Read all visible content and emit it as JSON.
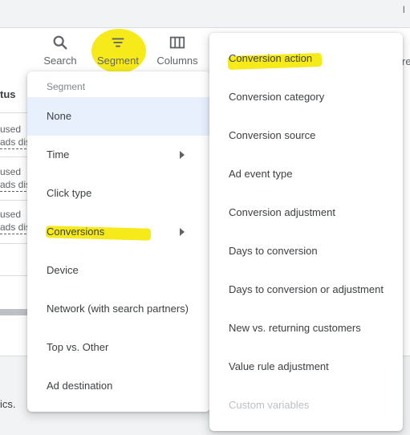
{
  "topbar": {
    "corner_letter": "l"
  },
  "toolbar": {
    "search_label": "Search",
    "segment_label": "Segment",
    "columns_label": "Columns",
    "more_label_partial": "re"
  },
  "table": {
    "column_header": "tus",
    "rows": [
      {
        "status": "used",
        "sub": "ads dis"
      },
      {
        "status": "used",
        "sub": "ads dis"
      },
      {
        "status": "used",
        "sub": "ads dis"
      }
    ]
  },
  "footer": {
    "text": "ics."
  },
  "segment_menu": {
    "header": "Segment",
    "items": [
      {
        "label": "None",
        "selected": true,
        "submenu": false
      },
      {
        "label": "Time",
        "selected": false,
        "submenu": true
      },
      {
        "label": "Click type",
        "selected": false,
        "submenu": false
      },
      {
        "label": "Conversions",
        "selected": false,
        "submenu": true
      },
      {
        "label": "Device",
        "selected": false,
        "submenu": false
      },
      {
        "label": "Network (with search partners)",
        "selected": false,
        "submenu": false
      },
      {
        "label": "Top vs. Other",
        "selected": false,
        "submenu": false
      },
      {
        "label": "Ad destination",
        "selected": false,
        "submenu": false
      }
    ]
  },
  "conversions_submenu": {
    "items": [
      {
        "label": "Conversion action",
        "disabled": false
      },
      {
        "label": "Conversion category",
        "disabled": false
      },
      {
        "label": "Conversion source",
        "disabled": false
      },
      {
        "label": "Ad event type",
        "disabled": false
      },
      {
        "label": "Conversion adjustment",
        "disabled": false
      },
      {
        "label": "Days to conversion",
        "disabled": false
      },
      {
        "label": "Days to conversion or adjustment",
        "disabled": false
      },
      {
        "label": "New vs. returning customers",
        "disabled": false
      },
      {
        "label": "Value rule adjustment",
        "disabled": false
      },
      {
        "label": "Custom variables",
        "disabled": true
      }
    ]
  },
  "colors": {
    "highlight": "#f7ea1a",
    "selected_bg": "#e8f0fe",
    "icon": "#5f6368",
    "disabled_text": "#bdc1c6"
  },
  "icons": {
    "search": "search-icon",
    "segment": "segment-icon",
    "columns": "columns-icon",
    "submenu_arrow": "chevron-right-icon"
  }
}
